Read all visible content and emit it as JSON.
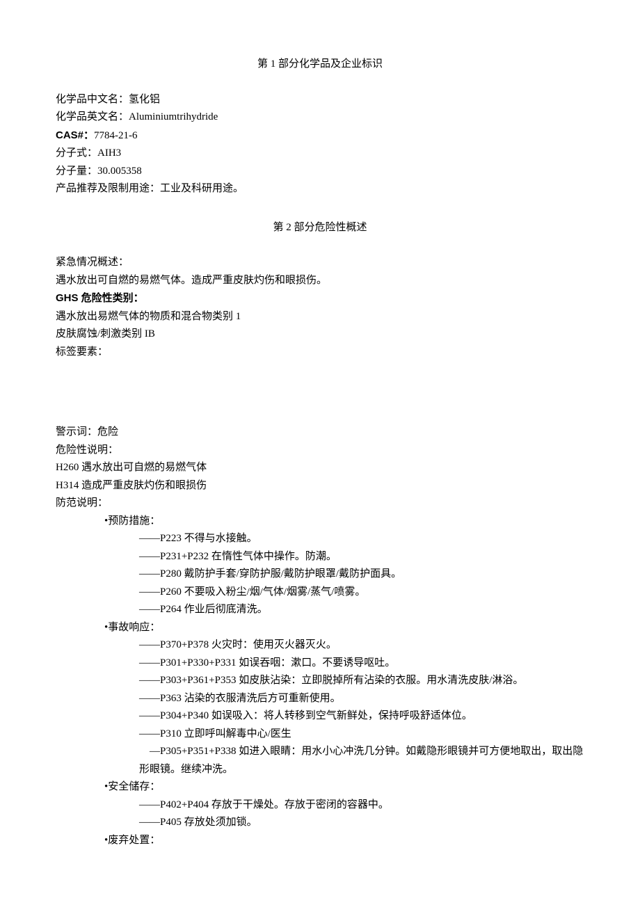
{
  "section1": {
    "heading": "第 1 部分化学品及企业标识",
    "name_cn_label": "化学品中文名：",
    "name_cn": "氢化铝",
    "name_en_label": "化学品英文名：",
    "name_en": "Aluminiumtrihydride",
    "cas_label": "CAS#：",
    "cas": "7784-21-6",
    "formula_label": "分子式：",
    "formula": "AIH3",
    "mw_label": "分子量：",
    "mw": "30.005358",
    "use_label": "产品推荐及限制用途：",
    "use": "工业及科研用途。"
  },
  "section2": {
    "heading": "第 2 部分危险性概述",
    "emergency_label": "紧急情况概述：",
    "emergency_text": "遇水放出可自燃的易燃气体。造成严重皮肤灼伤和眼损伤。",
    "ghs_label": "GHS 危险性类别：",
    "ghs_line1": "遇水放出易燃气体的物质和混合物类别 1",
    "ghs_line2": "皮肤腐蚀/刺激类别 IB",
    "label_elements": "标签要素：",
    "signal_label": "警示词：",
    "signal_word": "危险",
    "hazard_label": "危险性说明：",
    "h260": "H260 遇水放出可自燃的易燃气体",
    "h314": "H314 造成严重皮肤灼伤和眼损伤",
    "precaution_label": "防范说明：",
    "prevention_heading": "•预防措施：",
    "prevention": {
      "p223": "——P223 不得与水接触。",
      "p231_232": "——P231+P232 在惰性气体中操作。防潮。",
      "p280": "——P280 戴防护手套/穿防护服/戴防护眼罩/戴防护面具。",
      "p260": "——P260 不要吸入粉尘/烟/气体/烟雾/蒸气/喷雾。",
      "p264": "——P264 作业后彻底清洗。"
    },
    "response_heading": "•事故响应：",
    "response": {
      "p370_378": "——P370+P378 火灾时：使用灭火器灭火。",
      "p301_330_331": "——P301+P330+P331 如误吞咽：漱口。不要诱导呕吐。",
      "p303_361_353": "——P303+P361+P353 如皮肤沾染：立即脱掉所有沾染的衣服。用水清洗皮肤/淋浴。",
      "p363": "——P363 沾染的衣服清洗后方可重新使用。",
      "p304_340": "——P304+P340 如误吸入：将人转移到空气新鲜处，保持呼吸舒适体位。",
      "p310": "——P310 立即呼叫解毒中心/医生",
      "p305_351_338": "　—P305+P351+P338 如进入眼睛：用水小心冲洗几分钟。如戴隐形眼镜并可方便地取出，取出隐形眼镜。继续冲洗。"
    },
    "storage_heading": "•安全储存：",
    "storage": {
      "p402_404": "——P402+P404 存放于干燥处。存放于密闭的容器中。",
      "p405": "——P405 存放处须加锁。"
    },
    "disposal_heading": "•废弃处置："
  }
}
